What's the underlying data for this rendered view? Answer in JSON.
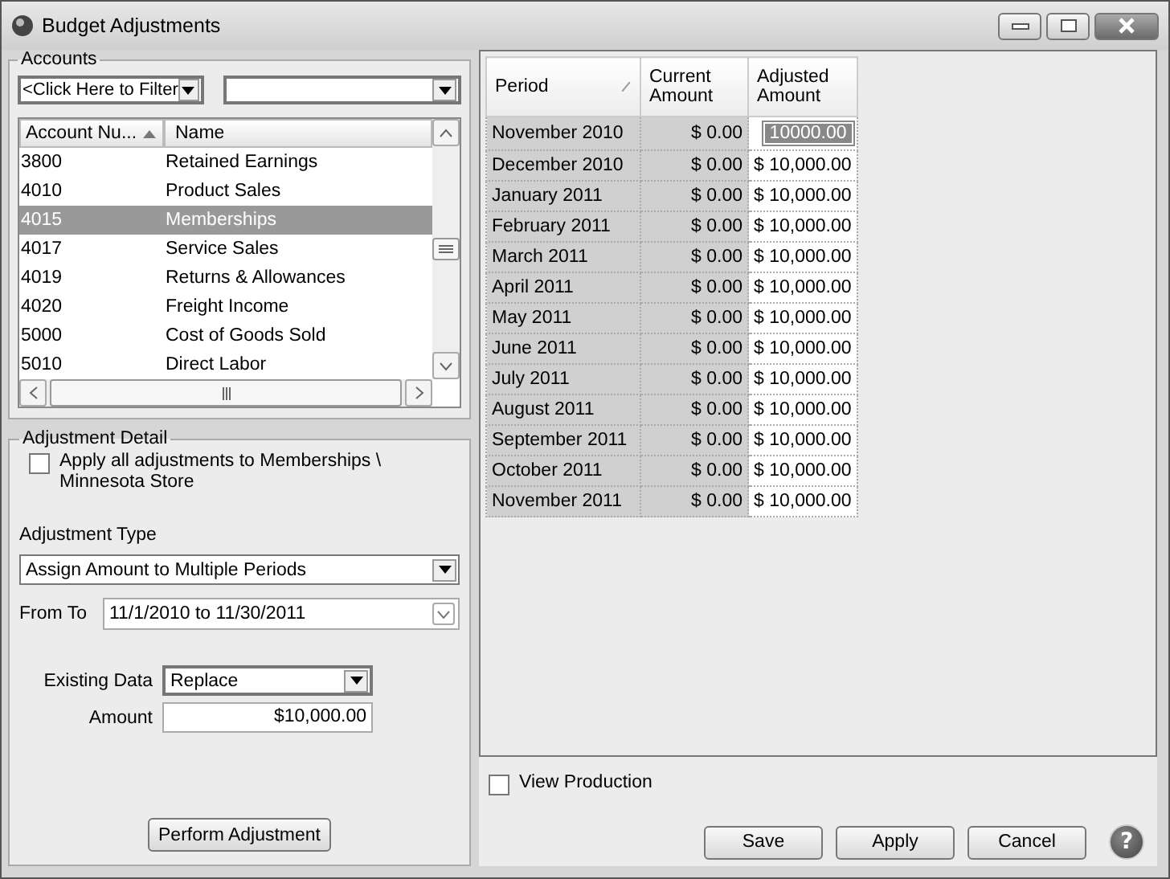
{
  "window": {
    "title": "Budget Adjustments"
  },
  "accounts": {
    "title": "Accounts",
    "filter": {
      "value": "<Click Here to Filter"
    },
    "columns": [
      {
        "label": "Account Nu..."
      },
      {
        "label": "Name"
      }
    ],
    "rows": [
      {
        "number": "3800",
        "name": "Retained Earnings",
        "selected": false
      },
      {
        "number": "4010",
        "name": "Product Sales",
        "selected": false
      },
      {
        "number": "4015",
        "name": "Memberships",
        "selected": true
      },
      {
        "number": "4017",
        "name": "Service Sales",
        "selected": false
      },
      {
        "number": "4019",
        "name": "Returns & Allowances",
        "selected": false
      },
      {
        "number": "4020",
        "name": "Freight Income",
        "selected": false
      },
      {
        "number": "5000",
        "name": "Cost of Goods Sold",
        "selected": false
      },
      {
        "number": "5010",
        "name": "Direct Labor",
        "selected": false
      }
    ]
  },
  "detail": {
    "title": "Adjustment Detail",
    "apply_all": {
      "label": "Apply all adjustments to Memberships \\ Minnesota Store",
      "checked": false
    },
    "adjustment_type": {
      "label": "Adjustment Type",
      "value": "Assign Amount to Multiple Periods"
    },
    "from_to": {
      "label": "From To",
      "value": "11/1/2010 to 11/30/2011"
    },
    "existing_data": {
      "label": "Existing Data",
      "value": "Replace"
    },
    "amount": {
      "label": "Amount",
      "value": "$10,000.00"
    },
    "button": "Perform Adjustment"
  },
  "grid": {
    "columns": [
      "Period",
      "Current Amount",
      "Adjusted Amount"
    ],
    "rows": [
      {
        "period": "November 2010",
        "current": "$ 0.00",
        "adjusted": "10000.00",
        "editing": true
      },
      {
        "period": "December 2010",
        "current": "$ 0.00",
        "adjusted": "$ 10,000.00",
        "editing": false
      },
      {
        "period": "January 2011",
        "current": "$ 0.00",
        "adjusted": "$ 10,000.00",
        "editing": false
      },
      {
        "period": "February 2011",
        "current": "$ 0.00",
        "adjusted": "$ 10,000.00",
        "editing": false
      },
      {
        "period": "March 2011",
        "current": "$ 0.00",
        "adjusted": "$ 10,000.00",
        "editing": false
      },
      {
        "period": "April 2011",
        "current": "$ 0.00",
        "adjusted": "$ 10,000.00",
        "editing": false
      },
      {
        "period": "May 2011",
        "current": "$ 0.00",
        "adjusted": "$ 10,000.00",
        "editing": false
      },
      {
        "period": "June 2011",
        "current": "$ 0.00",
        "adjusted": "$ 10,000.00",
        "editing": false
      },
      {
        "period": "July 2011",
        "current": "$ 0.00",
        "adjusted": "$ 10,000.00",
        "editing": false
      },
      {
        "period": "August 2011",
        "current": "$ 0.00",
        "adjusted": "$ 10,000.00",
        "editing": false
      },
      {
        "period": "September 2011",
        "current": "$ 0.00",
        "adjusted": "$ 10,000.00",
        "editing": false
      },
      {
        "period": "October 2011",
        "current": "$ 0.00",
        "adjusted": "$ 10,000.00",
        "editing": false
      },
      {
        "period": "November 2011",
        "current": "$ 0.00",
        "adjusted": "$ 10,000.00",
        "editing": false
      }
    ]
  },
  "view_production": {
    "label": "View Production",
    "checked": false
  },
  "buttons": [
    "Save",
    "Apply",
    "Cancel"
  ],
  "help": {
    "label": "?"
  }
}
